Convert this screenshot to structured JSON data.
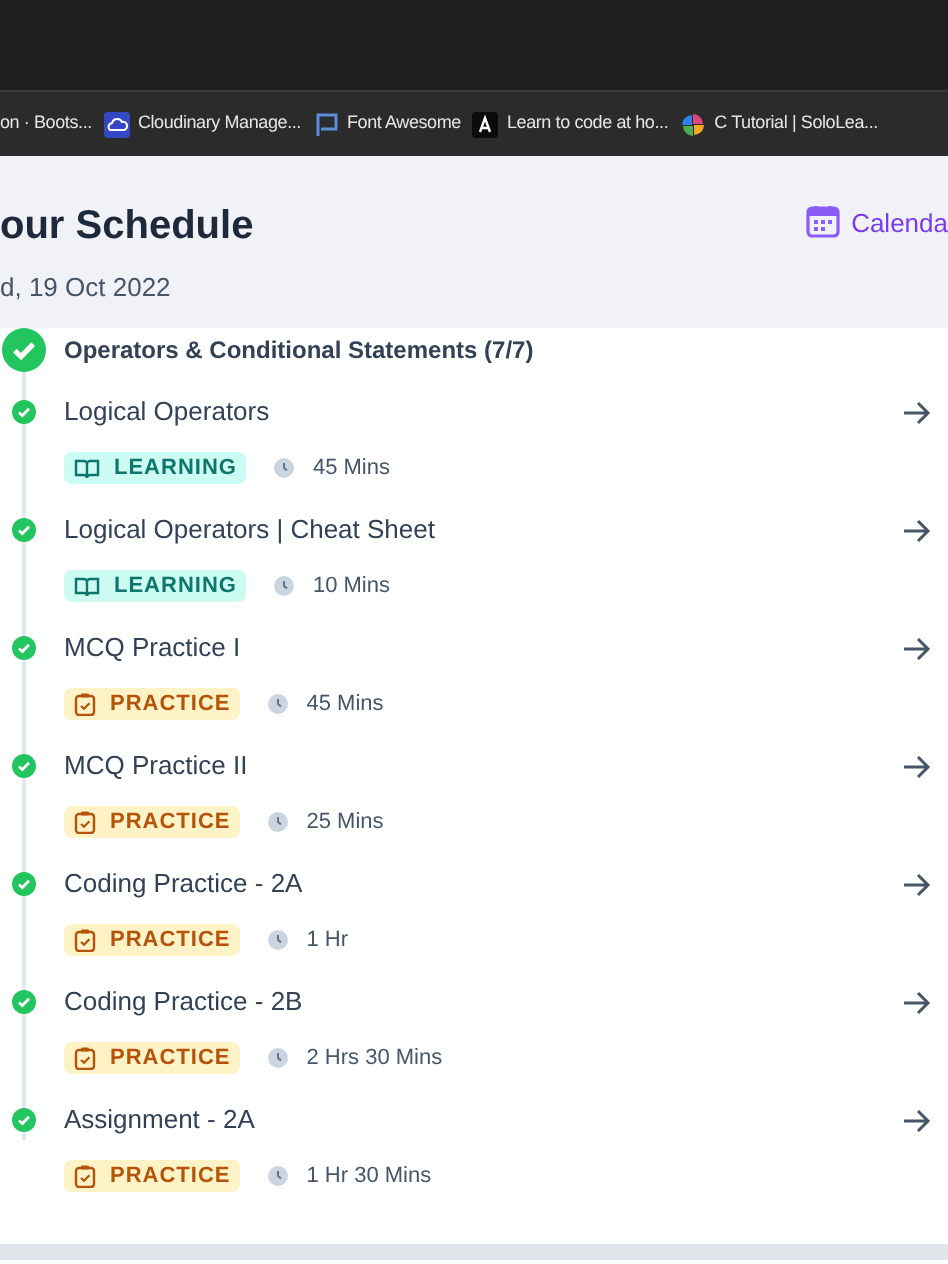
{
  "bookmarks": [
    {
      "label": "on · Boots..."
    },
    {
      "label": "Cloudinary Manage..."
    },
    {
      "label": "Font Awesome"
    },
    {
      "label": "Learn to code at ho..."
    },
    {
      "label": "C Tutorial | SoloLea..."
    }
  ],
  "header": {
    "title": "our Schedule",
    "date": "d, 19 Oct 2022",
    "calendar_link": "Calenda"
  },
  "section": {
    "title": "Operators & Conditional Statements (7/7)",
    "completed": true
  },
  "items": [
    {
      "title": "Logical Operators",
      "kind": "learning",
      "tag": "LEARNING",
      "duration": "45 Mins",
      "completed": true
    },
    {
      "title": "Logical Operators | Cheat Sheet",
      "kind": "learning",
      "tag": "LEARNING",
      "duration": "10 Mins",
      "completed": true
    },
    {
      "title": "MCQ Practice I",
      "kind": "practice",
      "tag": "PRACTICE",
      "duration": "45 Mins",
      "completed": true
    },
    {
      "title": "MCQ Practice II",
      "kind": "practice",
      "tag": "PRACTICE",
      "duration": "25 Mins",
      "completed": true
    },
    {
      "title": "Coding Practice - 2A",
      "kind": "practice",
      "tag": "PRACTICE",
      "duration": "1 Hr",
      "completed": true
    },
    {
      "title": "Coding Practice - 2B",
      "kind": "practice",
      "tag": "PRACTICE",
      "duration": "2 Hrs 30 Mins",
      "completed": true
    },
    {
      "title": "Assignment - 2A",
      "kind": "practice",
      "tag": "PRACTICE",
      "duration": "1 Hr 30 Mins",
      "completed": true
    }
  ]
}
